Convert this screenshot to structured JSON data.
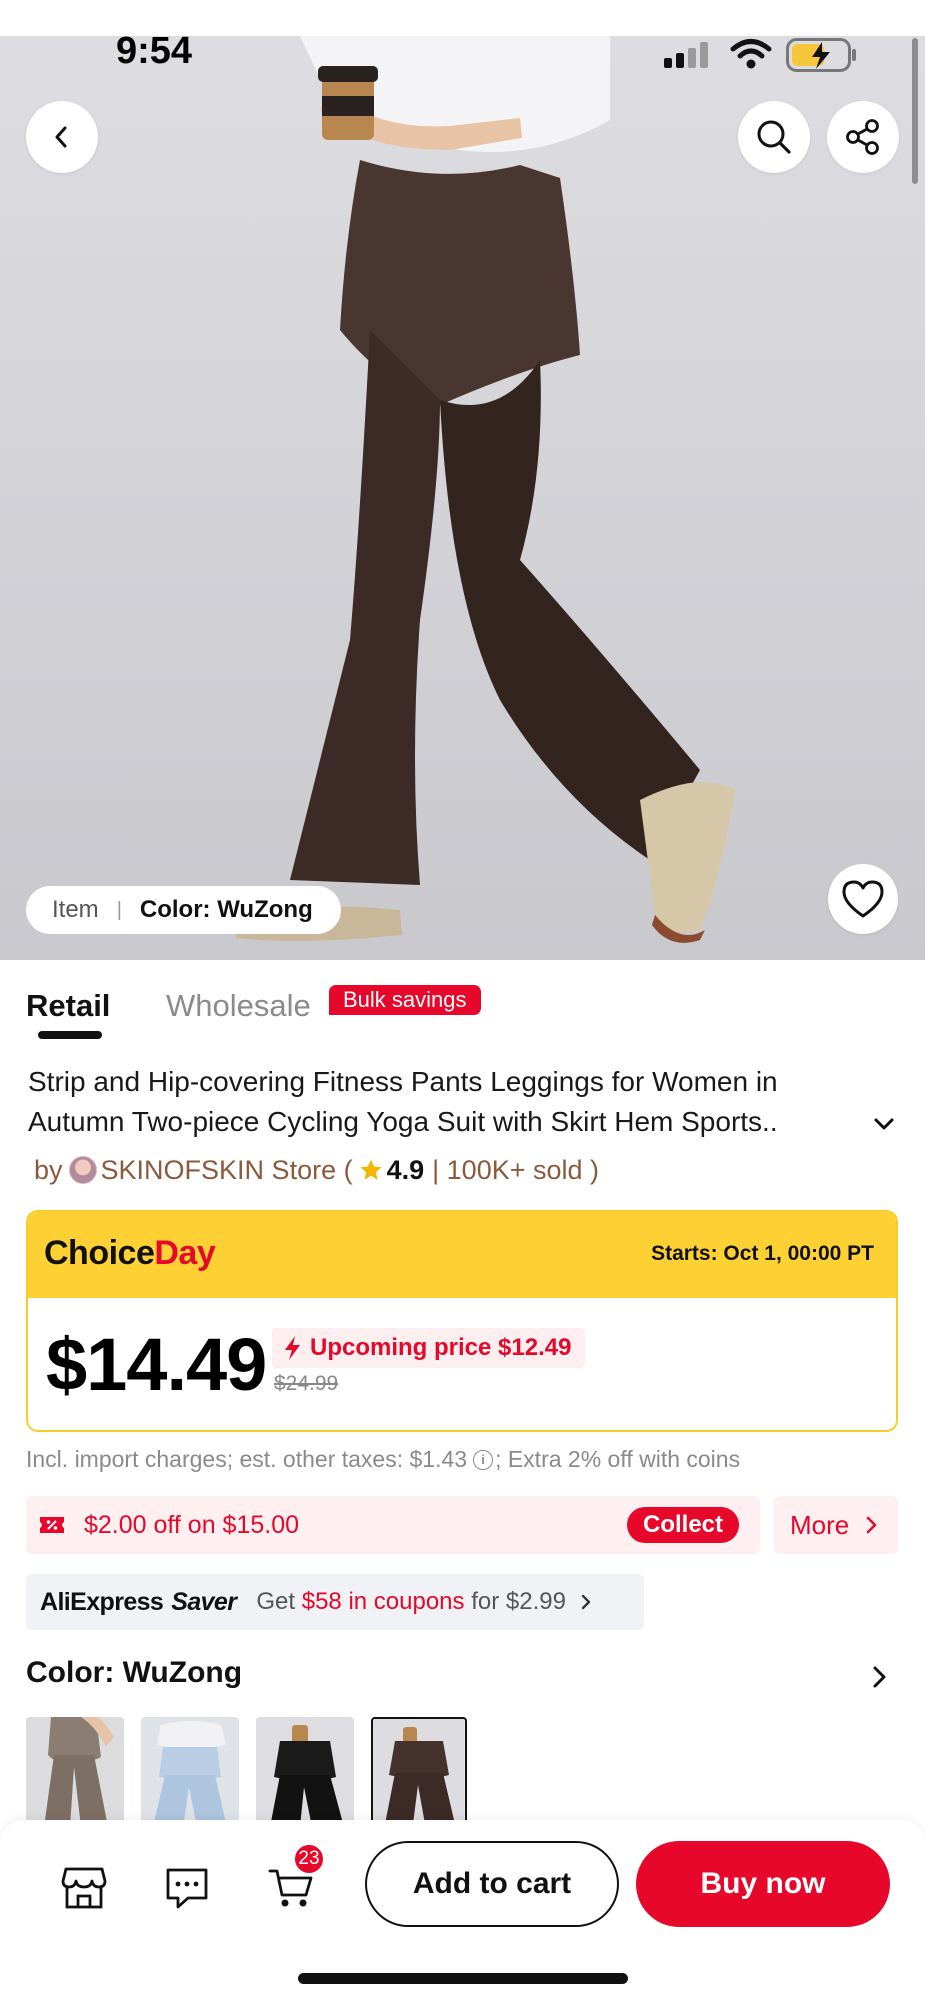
{
  "status_bar": {
    "time": "9:54"
  },
  "gallery": {
    "item_label": "Item",
    "color_label": "Color: WuZong"
  },
  "tabs": [
    {
      "label": "Retail",
      "active": true
    },
    {
      "label": "Wholesale",
      "active": false,
      "badge": "Bulk savings"
    }
  ],
  "product": {
    "title": "Strip and Hip-covering Fitness Pants Leggings for Women in Autumn Two-piece Cycling Yoga Suit with Skirt Hem Sports..",
    "by": "by",
    "store_name": "SKINOFSKIN Store (",
    "rating": "4.9",
    "sold": "| 100K+ sold )"
  },
  "choice_day": {
    "logo_part1": "Choice",
    "logo_part2": "Day",
    "starts": "Starts: Oct 1, 00:00 PT",
    "price": "$14.49",
    "upcoming": "Upcoming price $12.49",
    "original_price": "$24.99"
  },
  "tax_line": {
    "text_before": "Incl. import charges; est. other taxes: $1.43",
    "text_after": "; Extra 2% off with coins"
  },
  "coupon": {
    "text": "$2.00 off on $15.00",
    "collect_label": "Collect",
    "more_label": "More"
  },
  "saver": {
    "logo_ae": "AliExpress",
    "logo_saver": "Saver",
    "text_prefix": "Get",
    "text_amount": "$58 in coupons",
    "text_suffix": "for $2.99"
  },
  "color_section": {
    "title": "Color: WuZong",
    "options": [
      "taupe",
      "light-blue",
      "black",
      "wuzong-brown"
    ],
    "selected_index": 3
  },
  "bottom_bar": {
    "cart_count": "23",
    "add_to_cart": "Add to cart",
    "buy_now": "Buy now"
  },
  "colors": {
    "accent_red": "#e6072b",
    "choice_yellow": "#fdd134",
    "product_brown": "#3b2a26"
  }
}
